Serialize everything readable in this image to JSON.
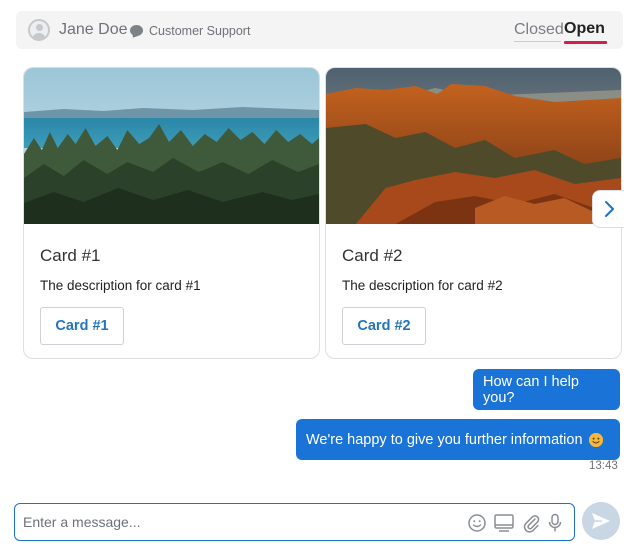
{
  "header": {
    "agent_name": "Jane Doe",
    "channel": "Customer Support",
    "tabs": [
      {
        "label": "Closed",
        "active": false
      },
      {
        "label": "Open",
        "active": true
      }
    ],
    "active_tab_color": "#d31f4b"
  },
  "cards": [
    {
      "title": "Card #1",
      "description": "The description for card #1",
      "button_label": "Card #1",
      "image": "forest-lake-landscape"
    },
    {
      "title": "Card #2",
      "description": "The description for card #2",
      "button_label": "Card #2",
      "image": "red-rock-canyon-sunset"
    }
  ],
  "messages": [
    {
      "text": "How can I help you?"
    },
    {
      "text": "We're happy to give you further information",
      "emoji": "smiling-face"
    }
  ],
  "timestamp": "13:43",
  "composer": {
    "placeholder": "Enter a message...",
    "value": "",
    "icons": [
      "emoji-icon",
      "screen-share-icon",
      "attachment-icon",
      "microphone-icon"
    ]
  },
  "colors": {
    "accent": "#1a73d6",
    "button_text": "#2475b9",
    "send_button": "#c9d6e3"
  }
}
